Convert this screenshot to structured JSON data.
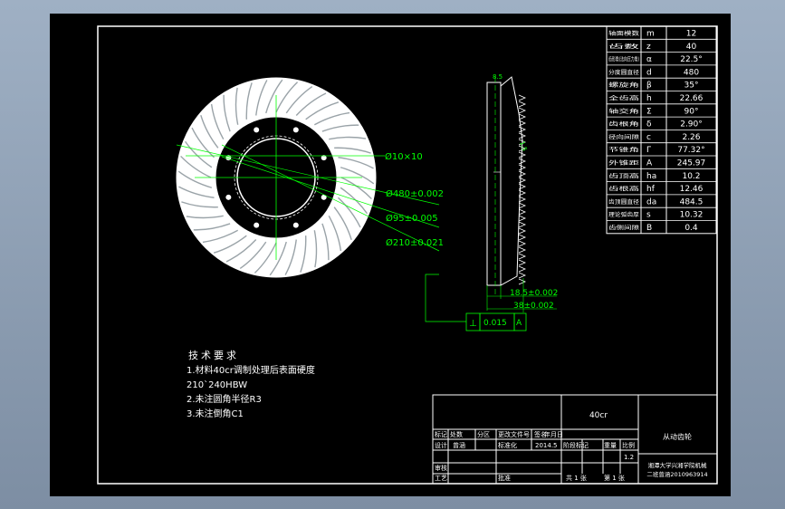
{
  "colors": {
    "background": "#000000",
    "lines": "#ffffff",
    "dimensions": "#00ff00",
    "viewport": "#8a9bb0"
  },
  "params": [
    [
      "轴面模数",
      "m",
      "12"
    ],
    [
      "齿数",
      "z",
      "40"
    ],
    [
      "齿形角(法向压力角)",
      "α",
      "22.5°"
    ],
    [
      "分度圆直径",
      "d",
      "480"
    ],
    [
      "螺旋角",
      "β",
      "35°"
    ],
    [
      "全齿高",
      "h",
      "22.66"
    ],
    [
      "轴交角",
      "Σ",
      "90°"
    ],
    [
      "齿根角",
      "δ",
      "2.90°"
    ],
    [
      "径向间隙",
      "c",
      "2.26"
    ],
    [
      "节锥角",
      "Γ",
      "77.32°"
    ],
    [
      "外锥距",
      "A",
      "245.97"
    ],
    [
      "齿顶高",
      "ha",
      "10.2"
    ],
    [
      "齿根高",
      "hf",
      "12.46"
    ],
    [
      "齿顶圆直径",
      "da",
      "484.5"
    ],
    [
      "理论弧齿厚",
      "s",
      "10.32"
    ],
    [
      "齿侧间隙",
      "B",
      "0.4"
    ]
  ],
  "dims": {
    "holes": "Ø10×10",
    "d480": "Ø480±0.002",
    "d95": "Ø95±0.005",
    "d210": "Ø210±0.021",
    "w185": "18.5±0.002",
    "w38": "38±0.002",
    "top": "8.5",
    "angle": "1.5"
  },
  "tolerance": {
    "symbol": "⊥",
    "value": "0.015",
    "datum": "A"
  },
  "tech_req": {
    "title": "技术要求",
    "lines": [
      "1.材料40cr调制处理后表面硬度",
      "210`240HBW",
      "2.未注圆角半径R3",
      "3.未注倒角C1"
    ]
  },
  "title_block": {
    "material": "40cr",
    "part_name": "从动齿轮",
    "school": "湘潭大学兴湘学院机械",
    "class": "二班曾涵2010963914",
    "headers": [
      "标记",
      "处数",
      "分区",
      "更改文件号",
      "签名",
      "年月日"
    ],
    "designer_label": "设计",
    "designer": "曾涵",
    "std_label": "标准化",
    "date": "2014.5",
    "stage_label": "阶段标记",
    "weight_label": "重量",
    "scale_label": "比例",
    "scale": "1.2",
    "review_label": "审核",
    "process_label": "工艺",
    "approve_label": "批准",
    "sheets": "共 1 张",
    "sheet_no": "第 1 张"
  }
}
